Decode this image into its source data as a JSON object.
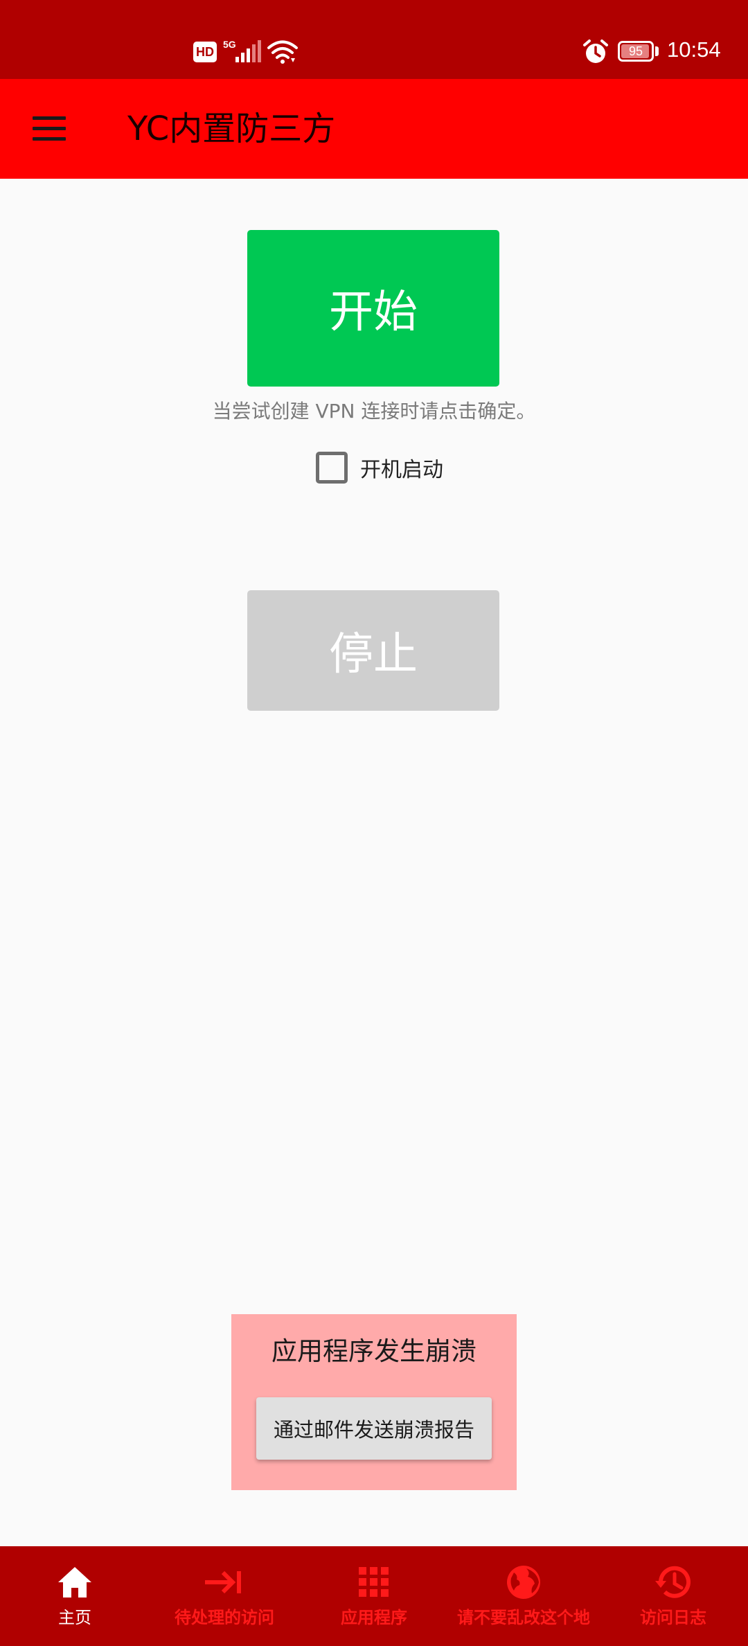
{
  "status_bar": {
    "hd_label": "HD",
    "network_label": "5G",
    "battery_percent": 95,
    "battery_text": "95",
    "time": "10:54"
  },
  "app_bar": {
    "title": "YC内置防三方"
  },
  "main": {
    "start_label": "开始",
    "hint": "当尝试创建 VPN 连接时请点击确定。",
    "autostart_label": "开机启动",
    "autostart_checked": false,
    "stop_label": "停止"
  },
  "crash_panel": {
    "title": "应用程序发生崩溃",
    "button_label": "通过邮件发送崩溃报告"
  },
  "bottom_nav": {
    "items": [
      {
        "label": "主页",
        "icon": "home-icon",
        "active": true
      },
      {
        "label": "待处理的访问",
        "icon": "arrow-to-bar-icon",
        "active": false
      },
      {
        "label": "应用程序",
        "icon": "apps-grid-icon",
        "active": false
      },
      {
        "label": "请不要乱改这个地",
        "icon": "globe-icon",
        "active": false
      },
      {
        "label": "访问日志",
        "icon": "history-icon",
        "active": false
      }
    ]
  },
  "colors": {
    "status_bar": "#b00000",
    "app_bar": "#ff0000",
    "start_button": "#00c853",
    "stop_button": "#cfcfcf",
    "crash_panel": "#ffaaaa",
    "nav_inactive": "#ff1a1a",
    "nav_active": "#ffffff"
  }
}
